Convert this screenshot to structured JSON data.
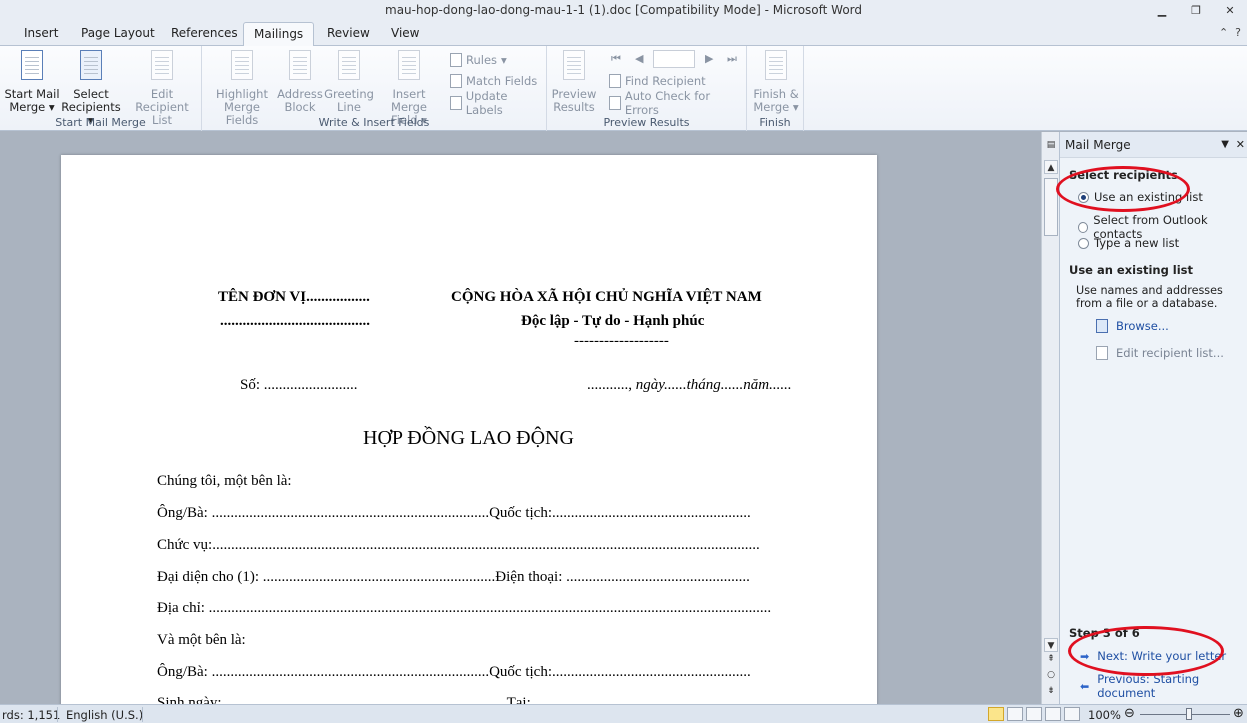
{
  "window": {
    "title": "mau-hop-dong-lao-dong-mau-1-1 (1).doc [Compatibility Mode] - Microsoft Word"
  },
  "tabs": [
    "Insert",
    "Page Layout",
    "References",
    "Mailings",
    "Review",
    "View"
  ],
  "ribbon": {
    "start_mail_merge": {
      "label": "Start Mail Merge",
      "start_mail_merge_btn": [
        "Start Mail",
        "Merge"
      ],
      "select_recipients_btn": [
        "Select",
        "Recipients"
      ],
      "edit_recipient_list_btn": [
        "Edit",
        "Recipient List"
      ]
    },
    "write_insert": {
      "label": "Write & Insert Fields",
      "highlight": [
        "Highlight",
        "Merge Fields"
      ],
      "address_block": [
        "Address",
        "Block"
      ],
      "greeting_line": [
        "Greeting",
        "Line"
      ],
      "insert_merge_field": [
        "Insert Merge",
        "Field"
      ],
      "rules": "Rules",
      "match_fields": "Match Fields",
      "update_labels": "Update Labels"
    },
    "preview": {
      "label": "Preview Results",
      "preview_results": [
        "Preview",
        "Results"
      ],
      "find_recipient": "Find Recipient",
      "auto_check": "Auto Check for Errors"
    },
    "finish": {
      "label": "Finish",
      "finish_merge": [
        "Finish &",
        "Merge"
      ]
    }
  },
  "document": {
    "left_header_1": "TÊN ĐƠN VỊ.................",
    "left_header_2": "........................................",
    "right_header_1": "CỘNG HÒA XÃ HỘI CHỦ NGHĨA VIỆT NAM",
    "right_header_2": "Độc lập - Tự do - Hạnh phúc",
    "right_header_3": "-------------------",
    "so": "Số: .........................",
    "date_prefix": "..........., ",
    "date_italic": "ngày......tháng......năm......",
    "title": "HỢP ĐỒNG LAO ĐỘNG",
    "lines": [
      "Chúng tôi, một bên là:",
      "Ông/Bà: ..........................................................................Quốc tịch:.....................................................",
      "Chức vụ:..................................................................................................................................................",
      "Đại diện cho (1):  ..............................................................Điện thoại: .................................................",
      "Địa chỉ: ......................................................................................................................................................",
      "Và một bên là:",
      "Ông/Bà: ..........................................................................Quốc tịch:.....................................................",
      "Sinh ngày: ...........................................................................Tại: ..........................................................."
    ]
  },
  "pane": {
    "title": "Mail Merge",
    "select_recipients": "Select recipients",
    "options": [
      "Use an existing list",
      "Select from Outlook contacts",
      "Type a new list"
    ],
    "selected_option": 0,
    "use_existing": "Use an existing list",
    "description": "Use names and addresses from a file or a database.",
    "browse": "Browse...",
    "edit_list": "Edit recipient list...",
    "step": "Step 3 of 6",
    "next": "Next: Write your letter",
    "previous": "Previous: Starting document"
  },
  "status": {
    "words": "rds: 1,151",
    "language": "English (U.S.)",
    "zoom": "100%"
  },
  "annotation_color": "#e01020"
}
